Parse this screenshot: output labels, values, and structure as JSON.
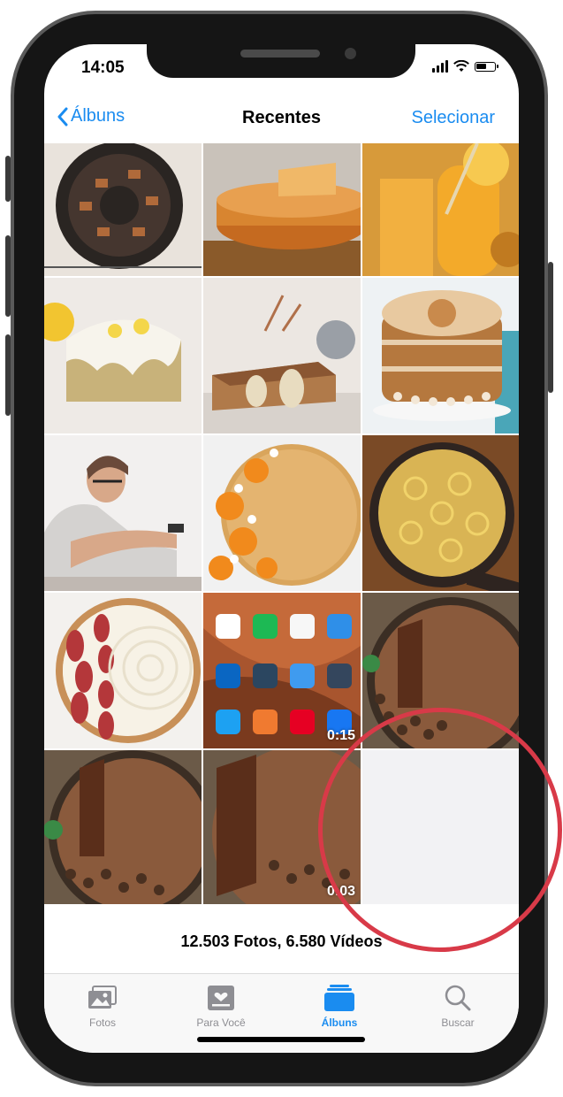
{
  "status_bar": {
    "time": "14:05"
  },
  "nav": {
    "back_label": "Álbuns",
    "title": "Recentes",
    "select_label": "Selecionar"
  },
  "photos": [
    {
      "kind": "photo",
      "subject": "chocolate-bundt-cake"
    },
    {
      "kind": "photo",
      "subject": "flan-dessert"
    },
    {
      "kind": "photo",
      "subject": "orange-juice-glasses"
    },
    {
      "kind": "photo",
      "subject": "lemon-loaf-cake"
    },
    {
      "kind": "photo",
      "subject": "pear-cake"
    },
    {
      "kind": "photo",
      "subject": "meringue-layer-cake"
    },
    {
      "kind": "photo",
      "subject": "man-with-phone"
    },
    {
      "kind": "photo",
      "subject": "orange-cake"
    },
    {
      "kind": "photo",
      "subject": "lemon-tart"
    },
    {
      "kind": "photo",
      "subject": "fig-cream-tart"
    },
    {
      "kind": "video",
      "subject": "phone-homescreen",
      "duration": "0:15"
    },
    {
      "kind": "photo",
      "subject": "chocolate-tart"
    },
    {
      "kind": "photo",
      "subject": "chocolate-tart"
    },
    {
      "kind": "video",
      "subject": "chocolate-tart",
      "duration": "0:03"
    }
  ],
  "footer": {
    "count": "12.503 Fotos, 6.580 Vídeos"
  },
  "tabs": [
    {
      "label": "Fotos",
      "icon": "photos-icon",
      "active": false
    },
    {
      "label": "Para Você",
      "icon": "for-you-icon",
      "active": false
    },
    {
      "label": "Álbuns",
      "icon": "albums-icon",
      "active": true
    },
    {
      "label": "Buscar",
      "icon": "search-icon",
      "active": false
    }
  ],
  "colors": {
    "accent": "#1a8cf0",
    "highlight": "#d83a48",
    "inactive": "#8e8e93"
  }
}
